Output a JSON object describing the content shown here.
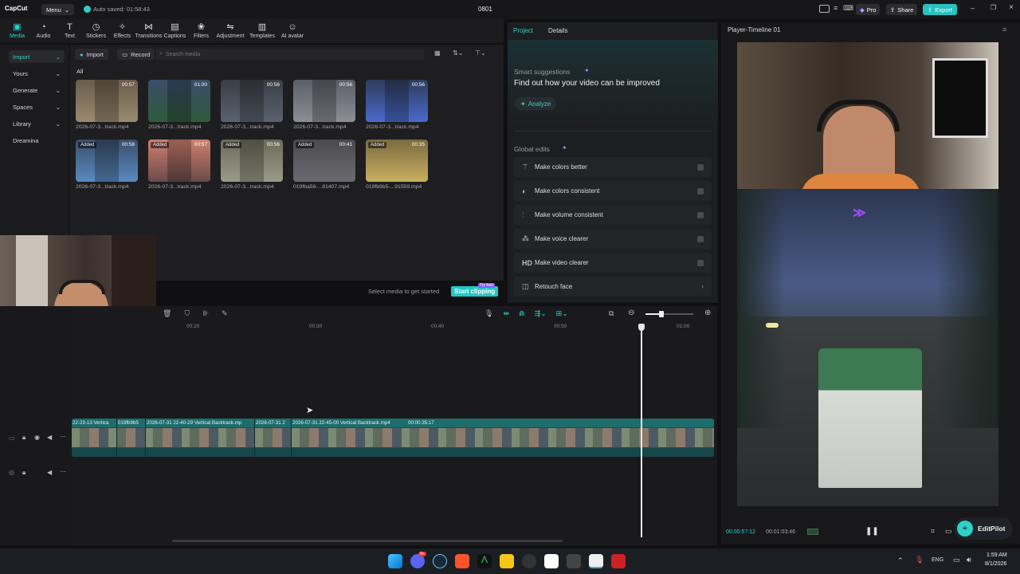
{
  "titlebar": {
    "app_name": "CapCut",
    "menu_label": "Menu",
    "autosave": "Auto saved: 01:58:43",
    "project_name": "0801",
    "pro_label": "Pro",
    "share_label": "Share",
    "export_label": "Export"
  },
  "toolbar": {
    "items": [
      {
        "label": "Media",
        "icon": "media-icon"
      },
      {
        "label": "Audio",
        "icon": "audio-icon"
      },
      {
        "label": "Text",
        "icon": "text-icon"
      },
      {
        "label": "Stickers",
        "icon": "stickers-icon"
      },
      {
        "label": "Effects",
        "icon": "effects-icon"
      },
      {
        "label": "Transitions",
        "icon": "transitions-icon"
      },
      {
        "label": "Captions",
        "icon": "captions-icon"
      },
      {
        "label": "Filters",
        "icon": "filters-icon"
      },
      {
        "label": "Adjustment",
        "icon": "adjustment-icon"
      },
      {
        "label": "Templates",
        "icon": "templates-icon"
      },
      {
        "label": "AI avatar",
        "icon": "ai-avatar-icon"
      }
    ]
  },
  "sidebar": {
    "items": [
      {
        "label": "Import"
      },
      {
        "label": "Yours"
      },
      {
        "label": "Generate"
      },
      {
        "label": "Spaces"
      },
      {
        "label": "Library"
      },
      {
        "label": "Dreamina"
      }
    ]
  },
  "media": {
    "import_label": "Import",
    "record_label": "Record",
    "search_placeholder": "Search media",
    "filter_all": "All",
    "items": [
      {
        "name": "2026-07-3...track.mp4",
        "duration": "00:57",
        "added": ""
      },
      {
        "name": "2026-07-3...track.mp4",
        "duration": "01:00",
        "added": ""
      },
      {
        "name": "2026-07-3...track.mp4",
        "duration": "00:56",
        "added": ""
      },
      {
        "name": "2026-07-3...track.mp4",
        "duration": "00:56",
        "added": ""
      },
      {
        "name": "2026-07-3...track.mp4",
        "duration": "00:56",
        "added": ""
      },
      {
        "name": "2026-07-3...track.mp4",
        "duration": "00:58",
        "added": "Added"
      },
      {
        "name": "2026-07-3...track.mp4",
        "duration": "00:57",
        "added": "Added"
      },
      {
        "name": "2026-07-3...track.mp4",
        "duration": "00:56",
        "added": "Added"
      },
      {
        "name": "019fba56-...81407.mp4",
        "duration": "00:41",
        "added": "Added"
      },
      {
        "name": "019fb9b5-...91559.mp4",
        "duration": "00:35",
        "added": "Added"
      }
    ],
    "hint": "Select media to get started",
    "clip_button": "Start clipping",
    "clip_badge": "Try free"
  },
  "panel": {
    "tab_project": "Project",
    "tab_details": "Details",
    "smart_title": "Smart suggestions",
    "smart_text": "Find out how your video can be improved",
    "analyze_label": "Analyze",
    "global_title": "Global edits",
    "edits": [
      {
        "label": "Make colors better",
        "icon": "magic-wand-icon"
      },
      {
        "label": "Make colors consistent",
        "icon": "color-consistent-icon"
      },
      {
        "label": "Make volume consistent",
        "icon": "volume-consistent-icon"
      },
      {
        "label": "Make voice clearer",
        "icon": "voice-clearer-icon"
      },
      {
        "label": "Make video clearer",
        "icon": "hd-icon"
      },
      {
        "label": "Retouch face",
        "icon": "retouch-face-icon"
      }
    ]
  },
  "player": {
    "title": "Player-Timeline 01",
    "current_time": "00:00:57:12",
    "total_time": "00:01:03:46",
    "editpilot": "EditPilot"
  },
  "timeline": {
    "ruler": [
      "00:20",
      "00:30",
      "00:40",
      "00:50",
      "01:00"
    ],
    "clip_labels": [
      "22-23-13 Vertica",
      "019fb9b5",
      "2026-07-31 22-40-29 Vertical Backtrack.mp",
      "2026-07-31 2",
      "2026-07-31 22-45-00 Vertical Backtrack.mp4",
      "00:00:35:17"
    ]
  },
  "taskbar": {
    "lang": "ENG",
    "time": "1:59 AM",
    "date": "8/1/2026",
    "discord_badge": "9+"
  }
}
